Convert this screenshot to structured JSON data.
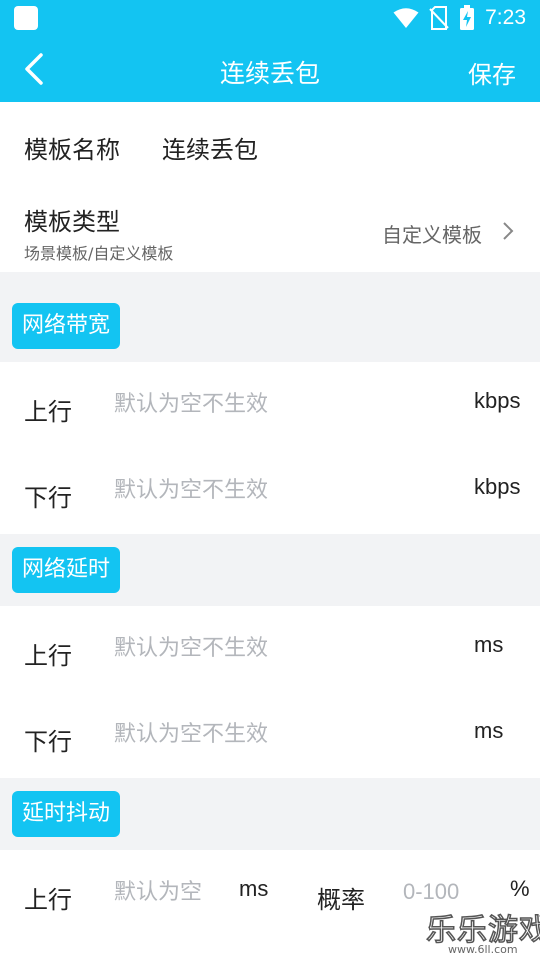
{
  "status_bar": {
    "time": "7:23"
  },
  "header": {
    "title": "连续丢包",
    "save_label": "保存"
  },
  "template": {
    "name_label": "模板名称",
    "name_value": "连续丢包",
    "type_label": "模板类型",
    "type_hint": "场景模板/自定义模板",
    "type_value": "自定义模板"
  },
  "bandwidth": {
    "title": "网络带宽",
    "rows": [
      {
        "label": "上行",
        "placeholder": "默认为空不生效",
        "unit": "kbps"
      },
      {
        "label": "下行",
        "placeholder": "默认为空不生效",
        "unit": "kbps"
      }
    ]
  },
  "latency": {
    "title": "网络延时",
    "rows": [
      {
        "label": "上行",
        "placeholder": "默认为空不生效",
        "unit": "ms"
      },
      {
        "label": "下行",
        "placeholder": "默认为空不生效",
        "unit": "ms"
      }
    ]
  },
  "jitter": {
    "title": "延时抖动",
    "row": {
      "label": "上行",
      "placeholder": "默认为空",
      "unit": "ms",
      "probability_label": "概率",
      "probability_placeholder": "0-100",
      "probability_unit": "%"
    }
  },
  "watermark": {
    "text": "乐乐游戏",
    "url": "www.6ll.com"
  },
  "colors": {
    "accent": "#13c4f2",
    "placeholder": "#b3b6bb",
    "background": "#f2f3f5"
  }
}
